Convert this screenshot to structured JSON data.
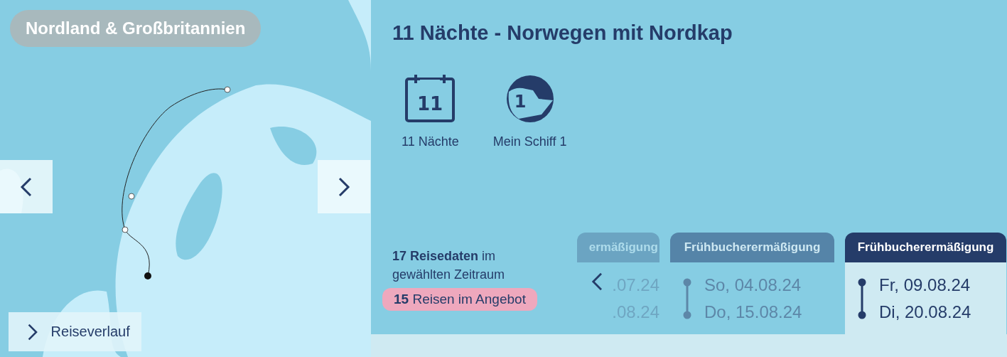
{
  "map": {
    "kind": "picture",
    "region_label": "Nordland & Großbritannien",
    "route_button": "Reiseverlauf"
  },
  "cruise": {
    "title": "11 Nächte - Norwegen mit Nordkap",
    "facts": [
      {
        "kind": "calendar",
        "icon_text": "11",
        "label": "11 Nächte"
      },
      {
        "kind": "ship",
        "icon_text": "1",
        "label": "Mein Schiff 1"
      }
    ],
    "dates_summary": "**17 Reisedaten** im gewählten Zeitraum",
    "offers_badge": "**15** Reisen im Angebot"
  },
  "date_cards": [
    {
      "tag": "ermäßigung",
      "start": ".07.24",
      "end": ".08.24",
      "selected": false,
      "faded": true
    },
    {
      "tag": "Frühbucherermäßigung",
      "start": "So, 04.08.24",
      "end": "Do, 15.08.24",
      "selected": false,
      "faded": false
    },
    {
      "tag": "Frühbucherermäßigung",
      "start": "Fr, 09.08.24",
      "end": "Di, 20.08.24",
      "selected": true,
      "faded": false
    }
  ]
}
